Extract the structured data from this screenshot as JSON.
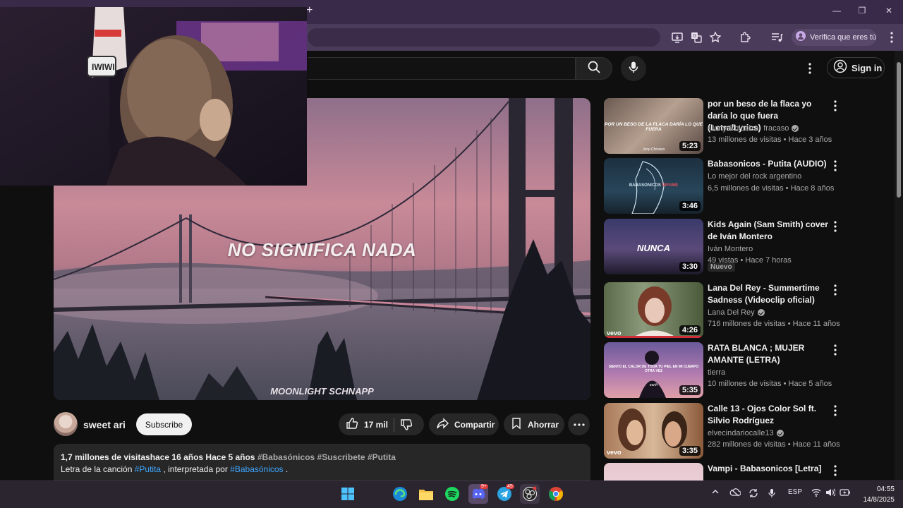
{
  "browser": {
    "new_tab_symbol": "+",
    "verify_label": "Verifica que eres tú"
  },
  "youtube_header": {
    "sign_in": "Sign in"
  },
  "video": {
    "lyric_text": "NO SIGNIFICA NADA",
    "watermark_text": "MOONLIGHT SCHNAPP"
  },
  "channel": {
    "name": "sweet ari",
    "subscribe_label": "Subscribe"
  },
  "actions": {
    "likes": "17 mil",
    "share": "Compartir",
    "save": "Ahorrar"
  },
  "description": {
    "stats": "1,7 millones de visitashace 16 años  Hace 5 años",
    "tags": "#Babasónicos #Suscribete #Putita",
    "line2_prefix": "Letra de la canción ",
    "line2_link1": "#Putita",
    "line2_middle": " , interpretada por ",
    "line2_link2": "#Babasónicos",
    "line2_suffix": " ."
  },
  "related": [
    {
      "title": "por un beso de la flaca yo daría lo que fuera (Letra/Lyrics)",
      "channel": "•Jony Chicaiza• fracaso",
      "verified": true,
      "meta": "13 millones de visitas • Hace 3 años",
      "duration": "5:23",
      "thumb_text": "POR UN BESO DE LA FLACA DARÍA LO QUE FUERA",
      "thumb_sub": "Jony Chicaiza"
    },
    {
      "title": "Babasonicos - Putita (AUDIO)",
      "channel": "Lo mejor del rock argentino",
      "verified": false,
      "meta": "6,5 millones de visitas • Hace 8 años",
      "duration": "3:46",
      "thumb_text": "BABASONICOS",
      "thumb_sub": "INFAME"
    },
    {
      "title": "Kids Again (Sam Smith) cover de Iván Montero",
      "channel": "Iván Montero",
      "verified": false,
      "meta": "49 vistas • Hace 7 horas",
      "duration": "3:30",
      "badge": "Nuevo",
      "thumb_text": "NUNCA"
    },
    {
      "title": "Lana Del Rey - Summertime Sadness (Videoclip oficial)",
      "channel": "Lana Del Rey",
      "verified": true,
      "meta": "716 millones de visitas • Hace 11 años",
      "duration": "4:26",
      "thumb_text": "vevo"
    },
    {
      "title": "RATA BLANCA ; MUJER AMANTE (LETRA)",
      "channel": "tierra",
      "verified": false,
      "meta": "10 millones de visitas • Hace 5 años",
      "duration": "5:35",
      "thumb_text": "SIENTO EL CALOR DE TODA TU PIEL EN MI CUERPO OTRA VEZ",
      "thumb_sub": "earth"
    },
    {
      "title": "Calle 13 - Ojos Color Sol ft. Silvio Rodríguez",
      "channel": "elvecindariocalle13",
      "verified": true,
      "meta": "282 millones de visitas • Hace 11 años",
      "duration": "3:35",
      "thumb_text": "vevo"
    },
    {
      "title": "Vampi - Babasonicos [Letra]",
      "channel": "",
      "verified": false,
      "meta": "",
      "duration": ""
    }
  ],
  "taskbar": {
    "discord_badge": "9+",
    "telegram_badge": "45",
    "lang": "ESP",
    "time": "04:55",
    "date": "14/8/2025"
  },
  "colors": {
    "accent_link": "#3ea6ff",
    "chrome_purple": "#4b3b5b",
    "yt_bg": "#0f0f0f"
  }
}
